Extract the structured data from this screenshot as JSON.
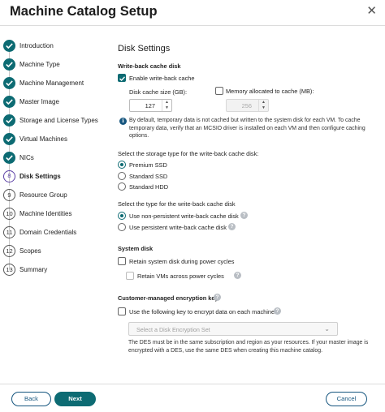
{
  "window": {
    "title": "Machine Catalog Setup"
  },
  "steps": [
    {
      "label": "Introduction",
      "state": "done"
    },
    {
      "label": "Machine Type",
      "state": "done"
    },
    {
      "label": "Machine Management",
      "state": "done"
    },
    {
      "label": "Master Image",
      "state": "done"
    },
    {
      "label": "Storage and License Types",
      "state": "done"
    },
    {
      "label": "Virtual Machines",
      "state": "done"
    },
    {
      "label": "NICs",
      "state": "done"
    },
    {
      "label": "Disk Settings",
      "state": "current",
      "number": "8"
    },
    {
      "label": "Resource Group",
      "state": "pending",
      "number": "9"
    },
    {
      "label": "Machine Identities",
      "state": "pending",
      "number": "10"
    },
    {
      "label": "Domain Credentials",
      "state": "pending",
      "number": "11"
    },
    {
      "label": "Scopes",
      "state": "pending",
      "number": "12"
    },
    {
      "label": "Summary",
      "state": "pending",
      "number": "13"
    }
  ],
  "content": {
    "heading": "Disk Settings",
    "write_back": {
      "section_label": "Write-back cache disk",
      "enable_label": "Enable write-back cache",
      "enable_checked": true,
      "cache_size_label": "Disk cache size (GB):",
      "cache_size_value": "127",
      "memory_label": "Memory allocated to cache (MB):",
      "memory_checked": false,
      "memory_value": "256",
      "info_text": "By default, temporary data is not cached but written to the system disk for each VM. To cache temporary data, verify that an MCSIO driver is installed on each VM and then configure caching options."
    },
    "storage_type": {
      "label": "Select the storage type for the write-back cache disk:",
      "options": [
        {
          "label": "Premium SSD",
          "selected": true
        },
        {
          "label": "Standard SSD",
          "selected": false
        },
        {
          "label": "Standard HDD",
          "selected": false
        }
      ]
    },
    "disk_type": {
      "label": "Select the type for the write-back cache disk",
      "options": [
        {
          "label": "Use non-persistent write-back cache disk",
          "selected": true
        },
        {
          "label": "Use persistent write-back cache disk",
          "selected": false
        }
      ]
    },
    "system_disk": {
      "section_label": "System disk",
      "retain_label": "Retain system disk during power cycles",
      "retain_checked": false,
      "retain_vms_label": "Retain VMs across power cycles",
      "retain_vms_checked": false
    },
    "encryption": {
      "section_label": "Customer-managed encryption key",
      "use_key_label": "Use the following key to encrypt data on each machine",
      "use_key_checked": false,
      "select_placeholder": "Select a Disk Encryption Set",
      "note_text": "The DES must be in the same subscription and region as your resources. If your master image is encrypted with a DES, use the same DES when creating this machine catalog."
    }
  },
  "footer": {
    "back_label": "Back",
    "next_label": "Next",
    "cancel_label": "Cancel"
  },
  "colors": {
    "accent": "#0d6b73",
    "link": "#16567f",
    "current_step": "#5b3fa6"
  },
  "icons": [
    "close-icon",
    "checkmark-icon",
    "info-icon",
    "help-icon",
    "chevron-down-icon"
  ]
}
